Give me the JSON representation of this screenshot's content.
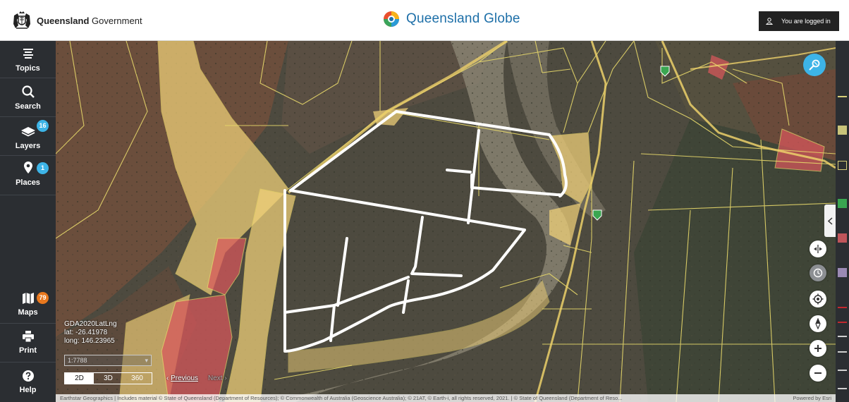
{
  "header": {
    "gov_name_bold": "Queensland",
    "gov_name_rest": " Government",
    "app_title": "Queensland Globe",
    "login_label": "You are logged in",
    "login_icon": "user-icon"
  },
  "sidebar": {
    "items": [
      {
        "label": "Topics",
        "icon": "topics-icon"
      },
      {
        "label": "Search",
        "icon": "search-icon"
      },
      {
        "label": "Layers",
        "icon": "layers-icon",
        "badge": "16"
      },
      {
        "label": "Places",
        "icon": "pin-icon",
        "badge": "1"
      },
      {
        "label": "Maps",
        "icon": "map-icon",
        "badge": "79"
      },
      {
        "label": "Print",
        "icon": "printer-icon"
      },
      {
        "label": "Help",
        "icon": "help-icon"
      }
    ]
  },
  "map": {
    "coordinates": {
      "system": "GDA2020LatLng",
      "lat": "lat: -26.41978",
      "long": "long: 146.23965"
    },
    "scale": "1:7788",
    "view_modes": [
      "2D",
      "3D",
      "360"
    ],
    "active_view": "2D",
    "nav": {
      "previous": "Previous",
      "next": "Next"
    },
    "controls": [
      "measure-icon",
      "compare-icon",
      "clock-icon",
      "locate-icon",
      "compass-icon",
      "zoom-in-icon",
      "zoom-out-icon"
    ],
    "attribution": "Earthstar Geographics | Includes material © State of Queensland (Department of Resources); © Commonwealth of Australia (Geoscience Australia); © 21AT, © Earth-i, all rights reserved, 2021. | © State of Queensland (Department of Reso...",
    "powered_by": "Powered by Esri"
  },
  "colors": {
    "header_title": "#1d6fa8",
    "sidebar_bg": "#2b2e32",
    "badge_blue": "#3db4e7",
    "badge_orange": "#e8781e",
    "parcel_yellow": "#f2d27a",
    "parcel_red": "#d9575c",
    "boundary_white": "#ffffff"
  }
}
